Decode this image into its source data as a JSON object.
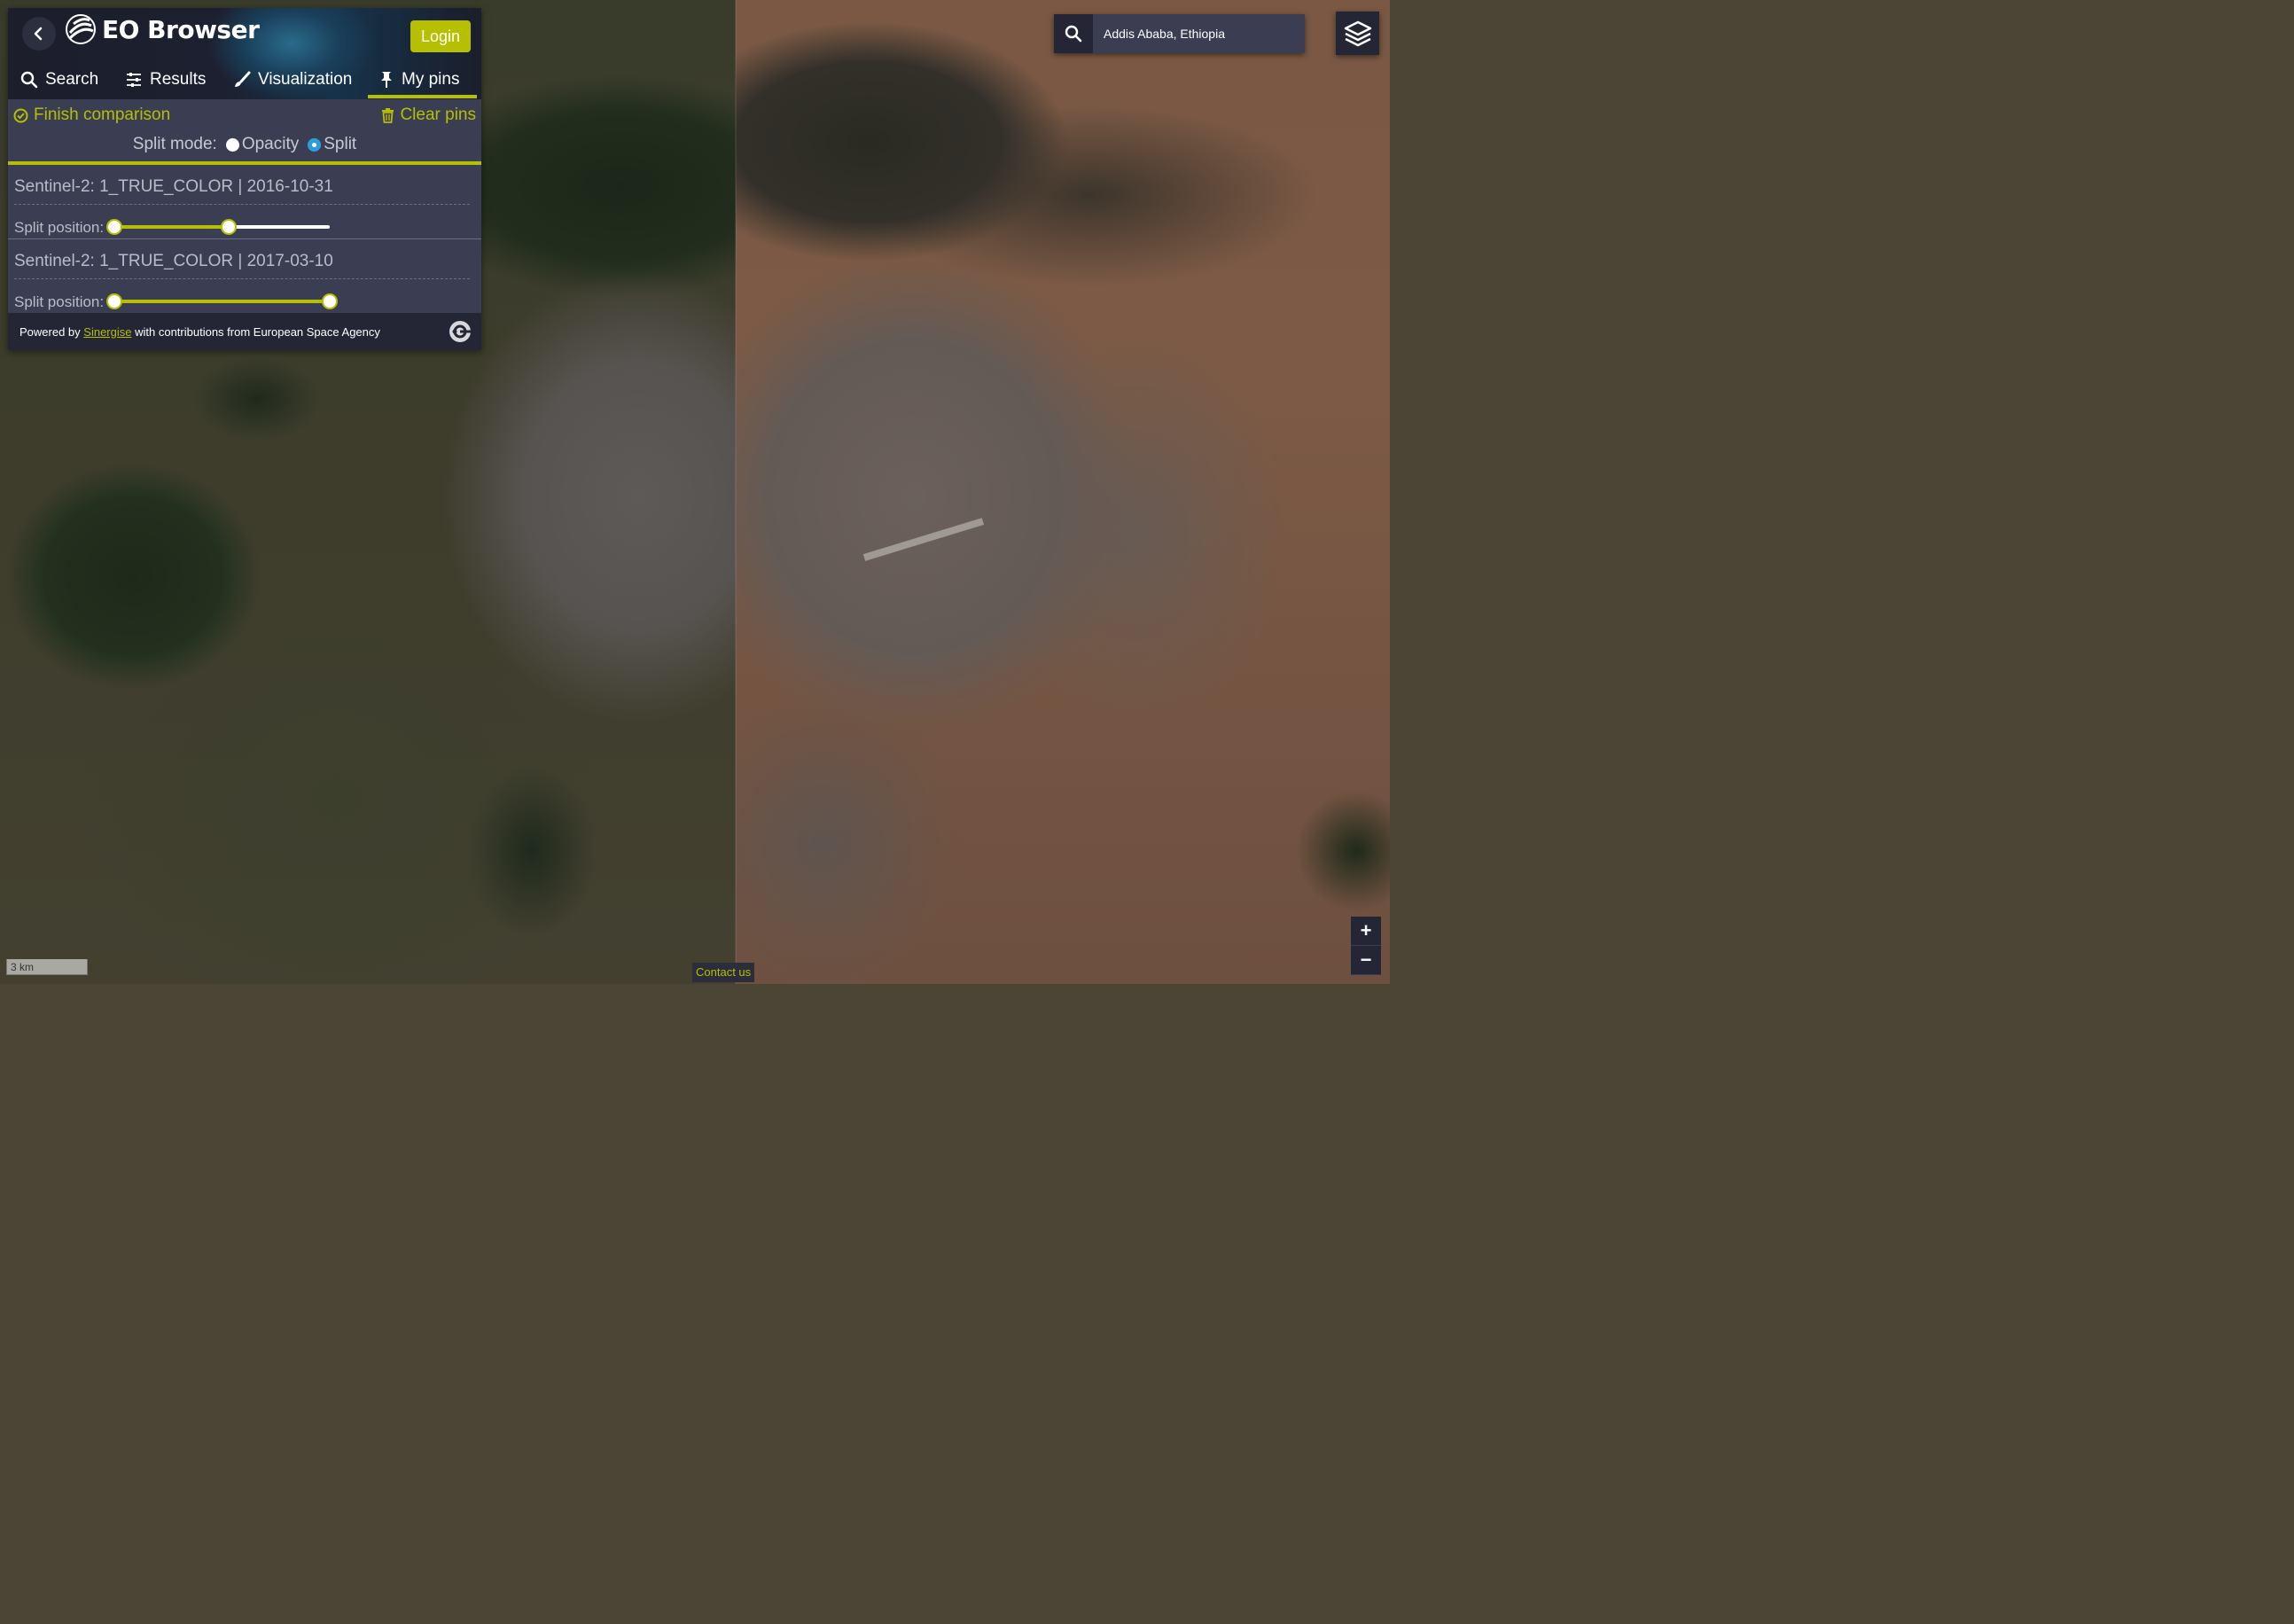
{
  "app": {
    "title": "EO Browser",
    "login_label": "Login"
  },
  "tabs": [
    {
      "label": "Search",
      "icon": "search-icon"
    },
    {
      "label": "Results",
      "icon": "sliders-icon"
    },
    {
      "label": "Visualization",
      "icon": "brush-icon"
    },
    {
      "label": "My pins",
      "icon": "pin-icon",
      "active": true
    }
  ],
  "pins_toolbar": {
    "finish_label": "Finish comparison",
    "clear_label": "Clear pins",
    "split_mode_label": "Split mode:",
    "options": [
      {
        "label": "Opacity",
        "checked": false
      },
      {
        "label": "Split",
        "checked": true
      }
    ]
  },
  "pins": [
    {
      "title": "Sentinel-2: 1_TRUE_COLOR | 2016-10-31",
      "split_label": "Split position:",
      "range_start": 0,
      "range_end": 0.53
    },
    {
      "title": "Sentinel-2: 1_TRUE_COLOR | 2017-03-10",
      "split_label": "Split position:",
      "range_start": 0,
      "range_end": 1.0
    }
  ],
  "footer": {
    "prefix": "Powered by",
    "link": "Sinergise",
    "suffix": "with contributions from European Space Agency"
  },
  "search": {
    "value": "Addis Ababa, Ethiopia"
  },
  "map": {
    "zoom_in": "+",
    "zoom_out": "−",
    "scale_label": "3 km",
    "contact_label": "Contact us"
  },
  "colors": {
    "accent": "#b6bf00",
    "panel_bg": "#3b3e52",
    "panel_dark": "#242636"
  }
}
